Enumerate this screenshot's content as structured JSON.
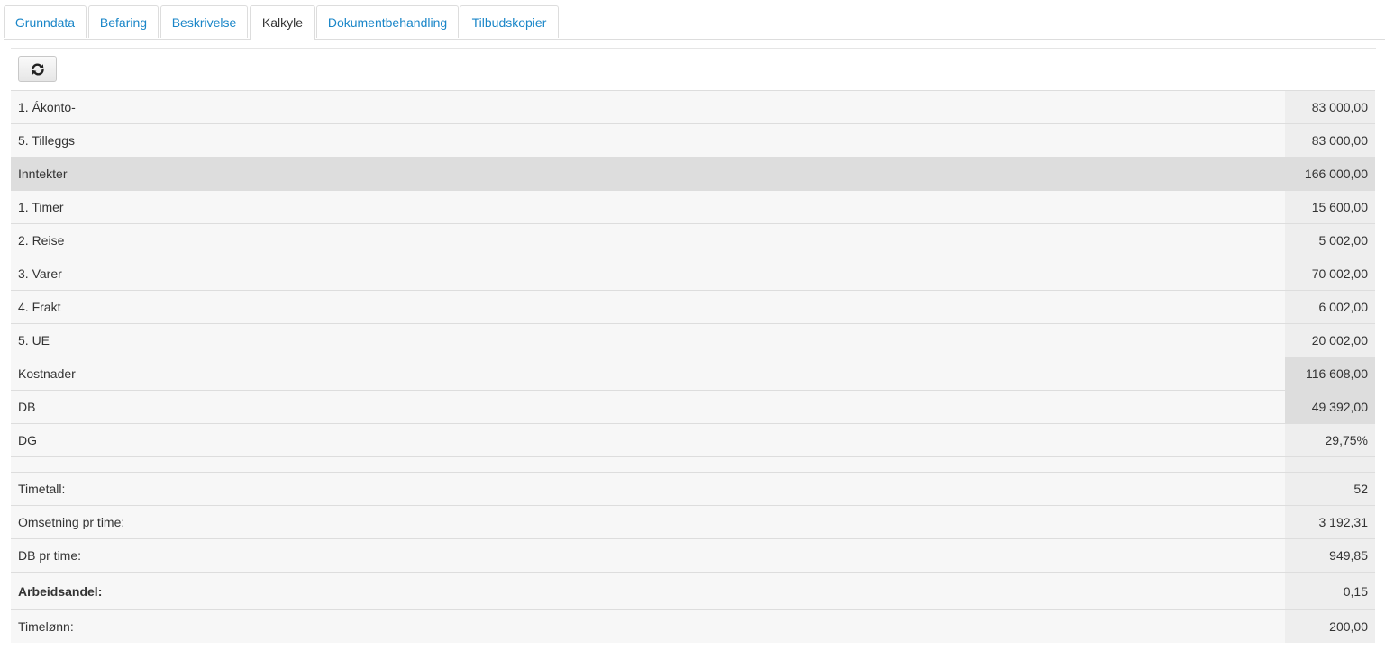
{
  "tabs": [
    {
      "label": "Grunndata",
      "active": false
    },
    {
      "label": "Befaring",
      "active": false
    },
    {
      "label": "Beskrivelse",
      "active": false
    },
    {
      "label": "Kalkyle",
      "active": true
    },
    {
      "label": "Dokumentbehandling",
      "active": false
    },
    {
      "label": "Tilbudskopier",
      "active": false
    }
  ],
  "toolbar": {
    "refresh_icon": "refresh-icon"
  },
  "rows": [
    {
      "label": "1. Ákonto-",
      "value": "83 000,00"
    },
    {
      "label": "5. Tilleggs",
      "value": "83 000,00"
    },
    {
      "label": "Inntekter",
      "value": "166 000,00"
    },
    {
      "label": "1. Timer",
      "value": "15 600,00"
    },
    {
      "label": "2. Reise",
      "value": "5 002,00"
    },
    {
      "label": "3. Varer",
      "value": "70 002,00"
    },
    {
      "label": "4. Frakt",
      "value": "6 002,00"
    },
    {
      "label": "5. UE",
      "value": "20 002,00"
    },
    {
      "label": "Kostnader",
      "value": "116 608,00"
    },
    {
      "label": "DB",
      "value": "49 392,00"
    },
    {
      "label": "DG",
      "value": "29,75%"
    },
    {
      "label": "Timetall:",
      "value": "52"
    },
    {
      "label": "Omsetning pr time:",
      "value": "3 192,31"
    },
    {
      "label": "DB pr time:",
      "value": "949,85"
    },
    {
      "label": "Arbeidsandel:",
      "value": "0,15"
    },
    {
      "label": "Timelønn:",
      "value": "200,00"
    }
  ],
  "colors": {
    "link": "#1a86c8",
    "sum_row": "#dddddd",
    "row_bg": "#f7f7f7"
  }
}
